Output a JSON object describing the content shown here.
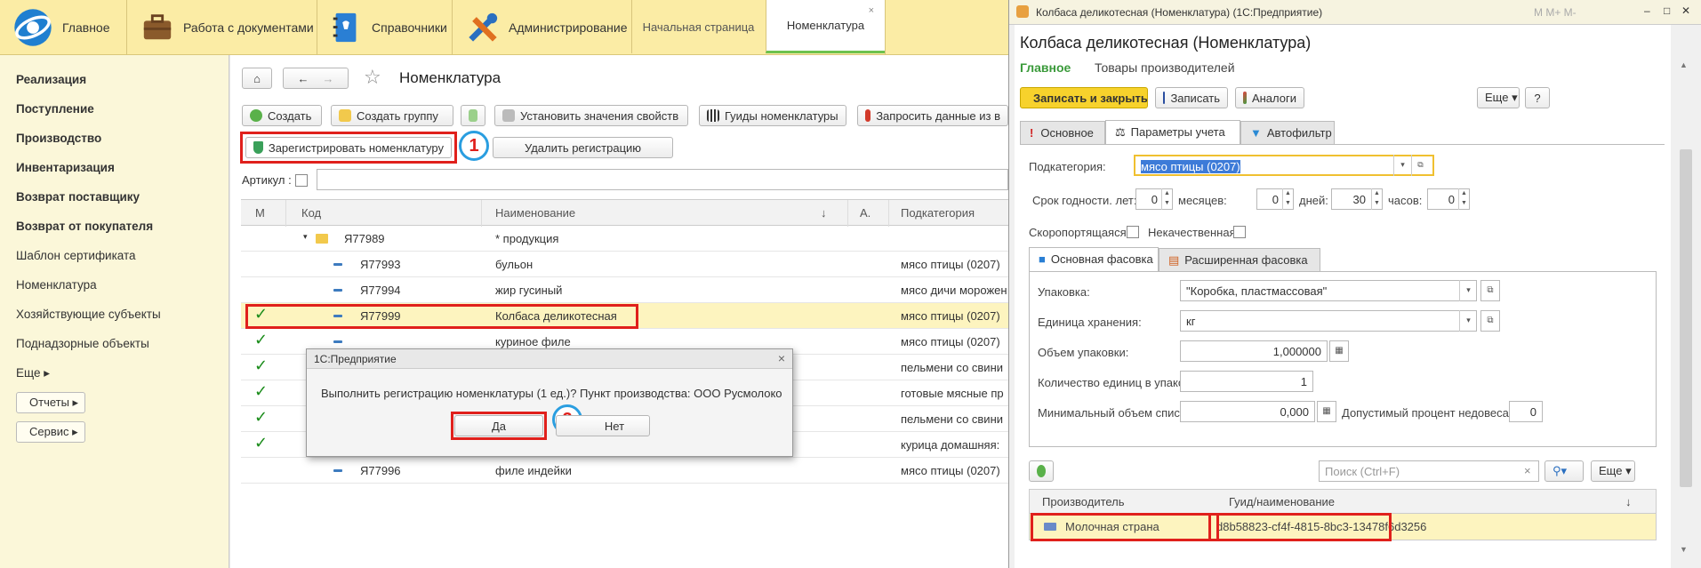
{
  "topbar": {
    "sections": [
      {
        "label": "Главное",
        "icon": "logo-1c-icon"
      },
      {
        "label": "Работа с документами",
        "icon": "briefcase-icon"
      },
      {
        "label": "Справочники",
        "icon": "address-book-icon"
      },
      {
        "label": "Администрирование",
        "icon": "tools-icon"
      }
    ],
    "window_tabs": [
      {
        "label": "Начальная страница"
      },
      {
        "label": "Номенклатура",
        "close": "×"
      }
    ]
  },
  "sidebar": {
    "items": [
      {
        "label": "Реализация",
        "bold": true
      },
      {
        "label": "Поступление",
        "bold": true
      },
      {
        "label": "Производство",
        "bold": true
      },
      {
        "label": "Инвентаризация",
        "bold": true
      },
      {
        "label": "Возврат поставщику",
        "bold": true
      },
      {
        "label": "Возврат от покупателя",
        "bold": true
      },
      {
        "label": "Шаблон сертификата",
        "bold": false
      },
      {
        "label": "Номенклатура",
        "bold": false
      },
      {
        "label": "Хозяйствующие субъекты",
        "bold": false
      },
      {
        "label": "Поднадзорные объекты",
        "bold": false
      },
      {
        "label": "Еще ▸",
        "bold": false
      }
    ],
    "buttons": [
      {
        "label": "Отчеты ▸"
      },
      {
        "label": "Сервис ▸"
      }
    ]
  },
  "list": {
    "title": "Номенклатура",
    "toolbar": {
      "create": "Создать",
      "create_group": "Создать группу",
      "set_props": "Установить значения свойств",
      "guids": "Гуиды номенклатуры",
      "request": "Запросить данные из в",
      "register": "Зарегистрировать номенклатуру",
      "unregister": "Удалить регистрацию"
    },
    "filter_label": "Артикул :",
    "columns": {
      "m": "М",
      "code": "Код",
      "name": "Наименование",
      "sort": "↓",
      "a": "А.",
      "subcat": "Подкатегория"
    },
    "rows": [
      {
        "check": "",
        "code": "Я77989",
        "name": "* продукция",
        "subcat": ""
      },
      {
        "check": "",
        "code": "Я77993",
        "name": "бульон",
        "subcat": "мясо птицы (0207)"
      },
      {
        "check": "",
        "code": "Я77994",
        "name": "жир гусиный",
        "subcat": "мясо дичи морожен"
      },
      {
        "check": "✓",
        "code": "Я77999",
        "name": "Колбаса деликотесная",
        "subcat": "мясо птицы (0207)"
      },
      {
        "check": "✓",
        "code": "",
        "name": "куриное филе",
        "subcat": "мясо птицы (0207)"
      },
      {
        "check": "✓",
        "code": "",
        "name": "",
        "subcat": "пельмени со свини"
      },
      {
        "check": "✓",
        "code": "",
        "name": "",
        "subcat": "готовые мясные пр"
      },
      {
        "check": "✓",
        "code": "",
        "name": "",
        "subcat": "пельмени со свини"
      },
      {
        "check": "✓",
        "code": "",
        "name": "",
        "subcat": "курица домашняя:"
      },
      {
        "check": "",
        "code": "Я77996",
        "name": "филе индейки",
        "subcat": "мясо птицы (0207)"
      }
    ],
    "badge1": "1",
    "badge2": "2"
  },
  "dialog": {
    "title": "1С:Предприятие",
    "message": "Выполнить регистрацию номенклатуры (1 ед.)? Пункт производства: ООО Русмолоко",
    "yes": "Да",
    "no": "Нет",
    "close": "×"
  },
  "item_window": {
    "titlebar": "Колбаса деликотесная (Номенклатура)  (1С:Предприятие)",
    "title_controls": "M  M+  M-",
    "heading": "Колбаса деликотесная (Номенклатура)",
    "nav": {
      "main": "Главное",
      "producers": "Товары производителей"
    },
    "buttons": {
      "save_close": "Записать и закрыть",
      "save": "Записать",
      "analogs": "Аналоги",
      "more": "Еще ▾",
      "help": "?"
    },
    "tabs": [
      {
        "label": "Основное"
      },
      {
        "label": "Параметры учета"
      },
      {
        "label": "Автофильтр"
      }
    ],
    "subcategory_label": "Подкатегория:",
    "subcategory_value": "мясо птицы (0207)",
    "shelf_life": {
      "years_label": "Срок годности. лет:",
      "years": "0",
      "months_label": "месяцев:",
      "months": "0",
      "days_label": "дней:",
      "days": "30",
      "hours_label": "часов:",
      "hours": "0"
    },
    "perishable_label": "Скоропортящаяся:",
    "substandard_label": "Некачественная:",
    "pack_tabs": [
      {
        "label": "Основная фасовка"
      },
      {
        "label": "Расширенная фасовка"
      }
    ],
    "pack": {
      "package_label": "Упаковка:",
      "package_value": "\"Коробка, пластмассовая\"",
      "unit_label": "Единица хранения:",
      "unit_value": "кг",
      "volume_label": "Объем упаковки:",
      "volume_value": "1,000000",
      "qty_label": "Количество единиц в упаковке:",
      "qty_value": "1",
      "min_label": "Минимальный объем списания:",
      "min_value": "0,000",
      "tol_label": "Допустимый процент недовеса:",
      "tol_value": "0"
    },
    "search_placeholder": "Поиск (Ctrl+F)",
    "search_clear": "×",
    "more2": "Еще ▾",
    "table": {
      "col1": "Производитель",
      "col2": "Гуид/наименование",
      "sort": "↓",
      "rows": [
        {
          "producer": "Молочная страна",
          "guid": "d8b58823-cf4f-4815-8bc3-13478f6d3256"
        }
      ]
    }
  }
}
